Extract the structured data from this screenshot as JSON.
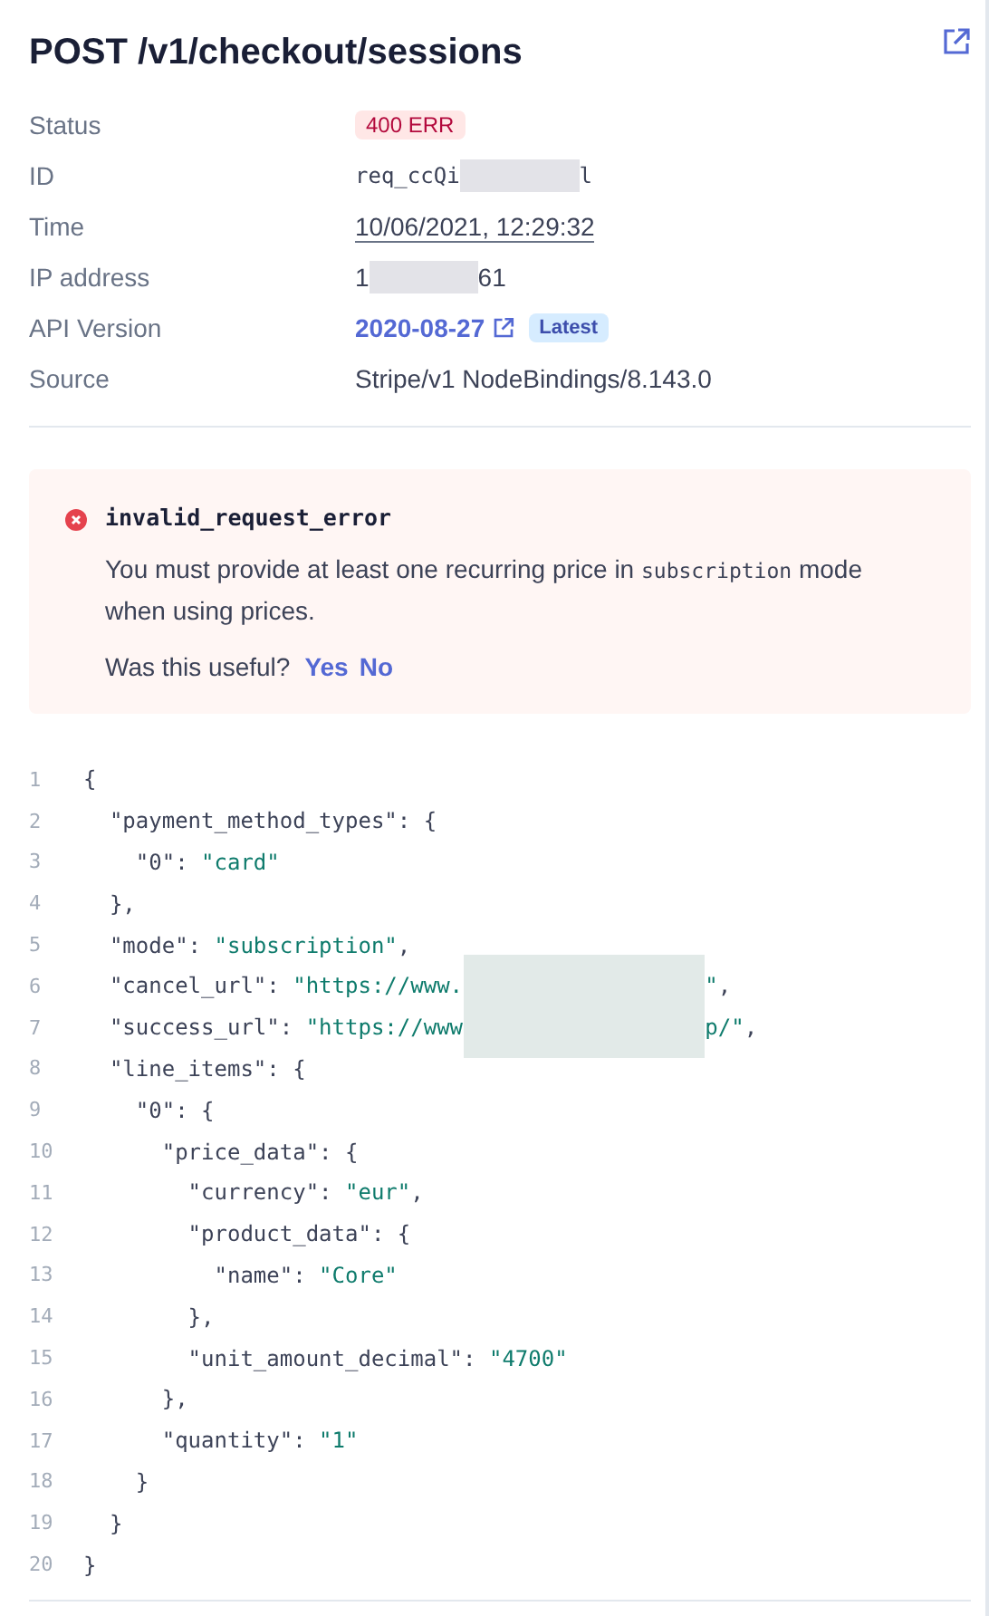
{
  "title": "POST /v1/checkout/sessions",
  "details": [
    {
      "label": "Status",
      "kind": "badge",
      "value": "400 ERR"
    },
    {
      "label": "ID",
      "kind": "redacted_mono",
      "prefix": "req_ccQi",
      "suffix": "l"
    },
    {
      "label": "Time",
      "kind": "underlined",
      "value": "10/06/2021, 12:29:32"
    },
    {
      "label": "IP address",
      "kind": "redacted",
      "prefix": "1",
      "suffix": "61"
    },
    {
      "label": "API Version",
      "kind": "version",
      "value": "2020-08-27",
      "tag": "Latest"
    },
    {
      "label": "Source",
      "kind": "plain",
      "value": "Stripe/v1 NodeBindings/8.143.0"
    }
  ],
  "error": {
    "code": "invalid_request_error",
    "message_parts": [
      "You must provide at least one recurring price in ",
      "subscription",
      " mode when using prices."
    ],
    "feedback_question": "Was this useful?",
    "feedback_options": [
      "Yes",
      "No"
    ]
  },
  "code_lines": [
    {
      "number": "1",
      "tokens": [
        {
          "kind": "punct",
          "text": "{"
        }
      ]
    },
    {
      "number": "2",
      "tokens": [
        {
          "kind": "key",
          "text": "  \"payment_method_types\""
        },
        {
          "kind": "punct",
          "text": ": {"
        }
      ]
    },
    {
      "number": "3",
      "tokens": [
        {
          "kind": "key",
          "text": "    \"0\""
        },
        {
          "kind": "punct",
          "text": ": "
        },
        {
          "kind": "str",
          "text": "\"card\""
        }
      ]
    },
    {
      "number": "4",
      "tokens": [
        {
          "kind": "punct",
          "text": "  },"
        }
      ]
    },
    {
      "number": "5",
      "tokens": [
        {
          "kind": "key",
          "text": "  \"mode\""
        },
        {
          "kind": "punct",
          "text": ": "
        },
        {
          "kind": "str",
          "text": "\"subscription\""
        },
        {
          "kind": "punct",
          "text": ","
        }
      ]
    },
    {
      "number": "6",
      "tokens": [
        {
          "kind": "key",
          "text": "  \"cancel_url\""
        },
        {
          "kind": "punct",
          "text": ": "
        },
        {
          "kind": "str",
          "text": "\"https://www."
        },
        {
          "kind": "redacted"
        },
        {
          "kind": "str",
          "text": "\""
        },
        {
          "kind": "punct",
          "text": ","
        }
      ]
    },
    {
      "number": "7",
      "tokens": [
        {
          "kind": "key",
          "text": "  \"success_url\""
        },
        {
          "kind": "punct",
          "text": ": "
        },
        {
          "kind": "str",
          "text": "\"https://www"
        },
        {
          "kind": "redacted"
        },
        {
          "kind": "str",
          "text": "p/\""
        },
        {
          "kind": "punct",
          "text": ","
        }
      ]
    },
    {
      "number": "8",
      "tokens": [
        {
          "kind": "key",
          "text": "  \"line_items\""
        },
        {
          "kind": "punct",
          "text": ": {"
        }
      ]
    },
    {
      "number": "9",
      "tokens": [
        {
          "kind": "key",
          "text": "    \"0\""
        },
        {
          "kind": "punct",
          "text": ": {"
        }
      ]
    },
    {
      "number": "10",
      "tokens": [
        {
          "kind": "key",
          "text": "      \"price_data\""
        },
        {
          "kind": "punct",
          "text": ": {"
        }
      ]
    },
    {
      "number": "11",
      "tokens": [
        {
          "kind": "key",
          "text": "        \"currency\""
        },
        {
          "kind": "punct",
          "text": ": "
        },
        {
          "kind": "str",
          "text": "\"eur\""
        },
        {
          "kind": "punct",
          "text": ","
        }
      ]
    },
    {
      "number": "12",
      "tokens": [
        {
          "kind": "key",
          "text": "        \"product_data\""
        },
        {
          "kind": "punct",
          "text": ": {"
        }
      ]
    },
    {
      "number": "13",
      "tokens": [
        {
          "kind": "key",
          "text": "          \"name\""
        },
        {
          "kind": "punct",
          "text": ": "
        },
        {
          "kind": "str",
          "text": "\"Core\""
        }
      ]
    },
    {
      "number": "14",
      "tokens": [
        {
          "kind": "punct",
          "text": "        },"
        }
      ]
    },
    {
      "number": "15",
      "tokens": [
        {
          "kind": "key",
          "text": "        \"unit_amount_decimal\""
        },
        {
          "kind": "punct",
          "text": ": "
        },
        {
          "kind": "str",
          "text": "\"4700\""
        }
      ]
    },
    {
      "number": "16",
      "tokens": [
        {
          "kind": "punct",
          "text": "      },"
        }
      ]
    },
    {
      "number": "17",
      "tokens": [
        {
          "kind": "key",
          "text": "      \"quantity\""
        },
        {
          "kind": "punct",
          "text": ": "
        },
        {
          "kind": "str",
          "text": "\"1\""
        }
      ]
    },
    {
      "number": "18",
      "tokens": [
        {
          "kind": "punct",
          "text": "    }"
        }
      ]
    },
    {
      "number": "19",
      "tokens": [
        {
          "kind": "punct",
          "text": "  }"
        }
      ]
    },
    {
      "number": "20",
      "tokens": [
        {
          "kind": "punct",
          "text": "}"
        }
      ]
    }
  ]
}
